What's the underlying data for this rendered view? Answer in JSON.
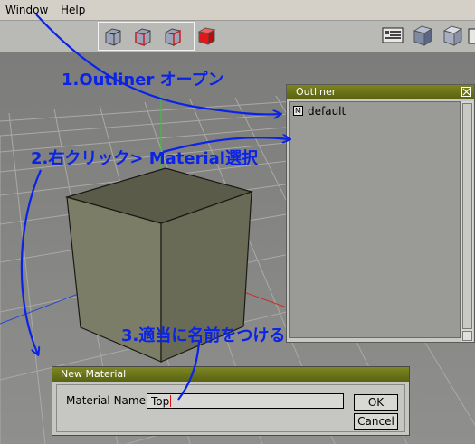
{
  "menu": {
    "items": [
      "Window",
      "Help"
    ]
  },
  "toolbar": {
    "view_buttons": [
      "wire-cube-icon",
      "wire-cube-front-icon",
      "wire-cube-side-icon",
      "solid-red-cube-icon"
    ],
    "right_icons": [
      "window-layout-icon",
      "shaded-cube-icon",
      "solid-cube-icon",
      "partial-icon"
    ]
  },
  "outliner": {
    "title": "Outliner",
    "item_icon_letter": "M",
    "item_label": "default"
  },
  "dialog": {
    "title": "New Material",
    "name_label": "Material Name",
    "name_value": "Top",
    "ok_label": "OK",
    "cancel_label": "Cancel"
  },
  "annotations": {
    "step1": "1.Outliner オープン",
    "step2": "2.右クリック> Material選択",
    "step3": "3.適当に名前をつける"
  },
  "colors": {
    "annotation": "#0a23e6",
    "titlebar": "#6b7419",
    "axis_x": "#c82828",
    "axis_y": "#32c832",
    "axis_z": "#2846dc"
  }
}
